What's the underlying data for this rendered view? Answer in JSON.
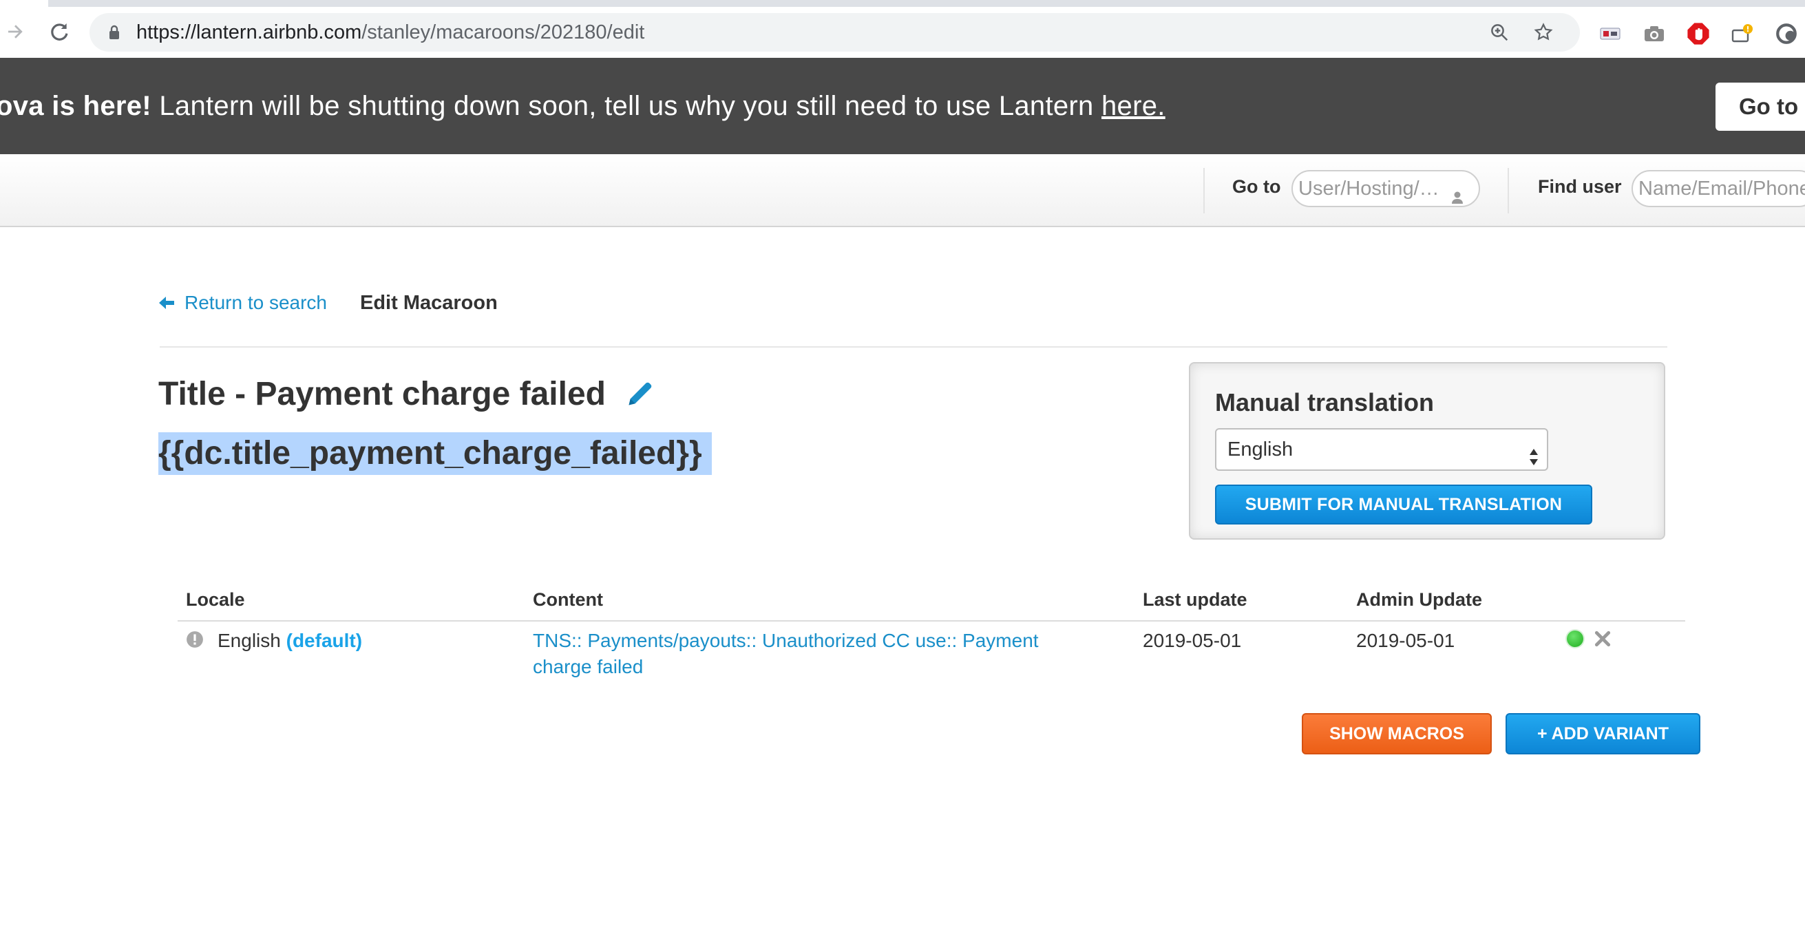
{
  "browser": {
    "url_host": "https://lantern.airbnb.com",
    "url_path": "/stanley/macaroons/202180/edit"
  },
  "banner": {
    "bold_text": "ova is here!",
    "message": " Lantern will be shutting down soon, tell us why you still need to use Lantern ",
    "link_text": "here.",
    "button_label": "Go to"
  },
  "header": {
    "goto_label": "Go to",
    "goto_placeholder": "User/Hosting/…",
    "find_user_label": "Find user",
    "find_user_placeholder": "Name/Email/Phone"
  },
  "breadcrumb": {
    "back_label": "Return to search",
    "current": "Edit Macaroon"
  },
  "macaroon": {
    "title": "Title - Payment charge failed",
    "key": "{{dc.title_payment_charge_failed}}"
  },
  "manual_translation": {
    "heading": "Manual translation",
    "selected_language": "English",
    "submit_label": "SUBMIT FOR MANUAL TRANSLATION"
  },
  "table": {
    "headers": {
      "locale": "Locale",
      "content": "Content",
      "last_update": "Last update",
      "admin_update": "Admin Update"
    },
    "rows": [
      {
        "locale": "English",
        "default_tag": "(default)",
        "content": "TNS:: Payments/payouts:: Unauthorized CC use:: Payment charge failed",
        "last_update": "2019-05-01",
        "admin_update": "2019-05-01",
        "status": "active"
      }
    ]
  },
  "actions": {
    "show_macros": "SHOW MACROS",
    "add_variant": "+ ADD VARIANT"
  },
  "colors": {
    "accent_blue": "#1a8fc9",
    "button_blue": "#0d86d6",
    "button_orange": "#ec5f16",
    "banner_bg": "#484848",
    "status_green": "#1fae1f"
  }
}
